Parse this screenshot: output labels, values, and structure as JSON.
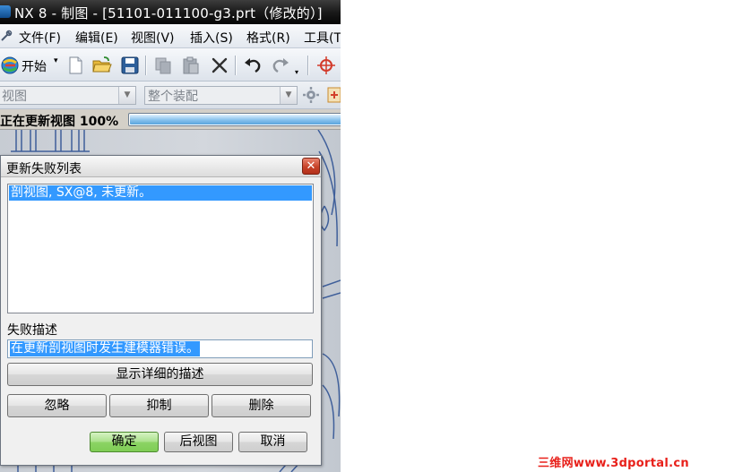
{
  "window": {
    "title": "NX 8 - 制图 - [51101-011100-g3.prt（修改的）]"
  },
  "menubar": {
    "items": [
      "文件(F)",
      "编辑(E)",
      "视图(V)",
      "插入(S)",
      "格式(R)",
      "工具(T)"
    ]
  },
  "toolbar": {
    "start_label": "开始",
    "start_arrow": "▾",
    "icons": [
      "start-globe-icon",
      "new-file-icon",
      "open-folder-icon",
      "save-icon",
      "copy-icon",
      "paste-icon",
      "delete-icon",
      "undo-icon",
      "redo-icon",
      "wcs-icon"
    ]
  },
  "selection_bar": {
    "filter_value": "视图",
    "assembly_value": "整个装配"
  },
  "status": {
    "text": "正在更新视图 100%",
    "progress_fraction": 1.0
  },
  "dialog": {
    "title": "更新失败列表",
    "close_glyph": "✕",
    "list_items": [
      "剖视图, SX@8, 未更新。"
    ],
    "description_label": "失败描述",
    "description_value": "在更新剖视图时发生建模器错误。",
    "detail_button": "显示详细的描述",
    "ignore_button": "忽略",
    "suppress_button": "抑制",
    "delete_button": "删除",
    "ok_button": "确定",
    "back_button": "后视图",
    "cancel_button": "取消"
  },
  "watermark": "三维网www.3dportal.cn",
  "colors": {
    "selection": "#3399ff",
    "close_button": "#c74228",
    "ok_button": "#8cd465",
    "watermark": "#e8201a",
    "drawing_lines": "#3f5f9a"
  }
}
